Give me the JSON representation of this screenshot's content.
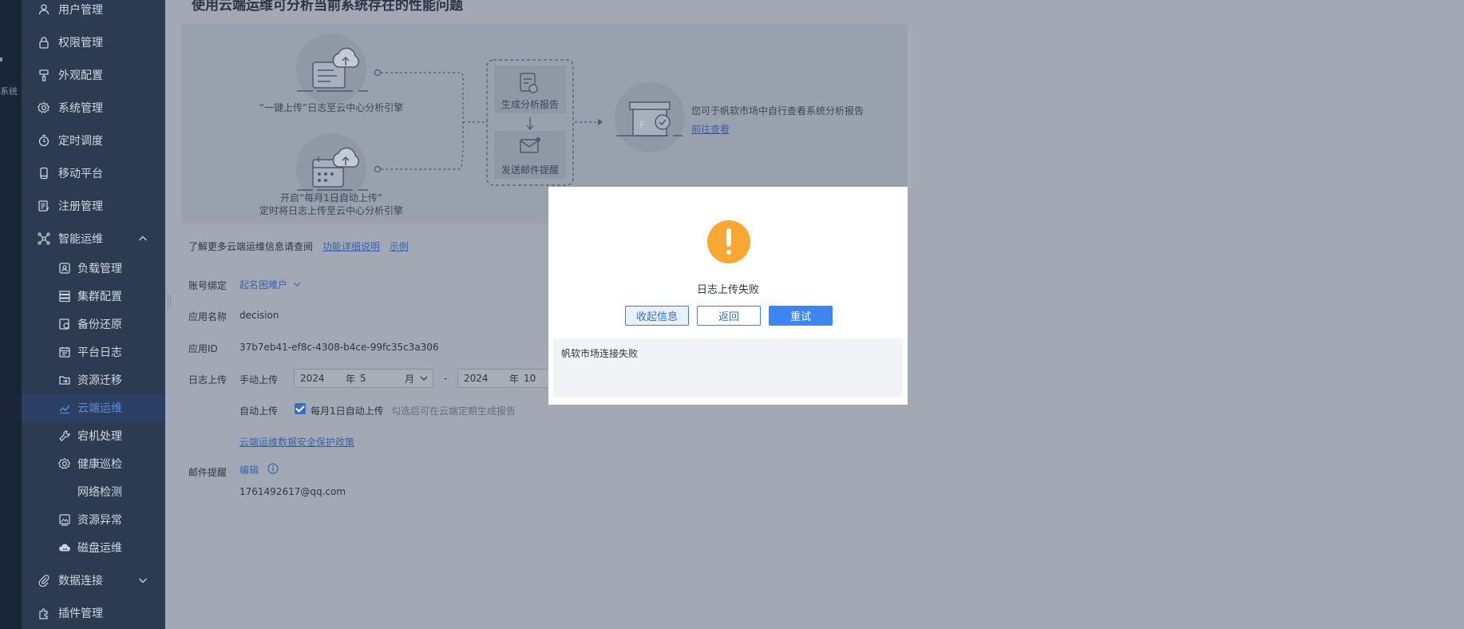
{
  "rail": {
    "top_text": "",
    "label": "系统"
  },
  "sidebar": {
    "items": [
      {
        "label": "用户管理",
        "icon": "user-icon"
      },
      {
        "label": "权限管理",
        "icon": "lock-icon"
      },
      {
        "label": "外观配置",
        "icon": "brush-icon"
      },
      {
        "label": "系统管理",
        "icon": "gear-icon"
      },
      {
        "label": "定时调度",
        "icon": "timer-icon"
      },
      {
        "label": "移动平台",
        "icon": "mobile-icon"
      },
      {
        "label": "注册管理",
        "icon": "register-icon"
      },
      {
        "label": "智能运维",
        "icon": "network-icon",
        "expanded": true
      }
    ],
    "sub_items": [
      {
        "label": "负载管理",
        "icon": "load-icon"
      },
      {
        "label": "集群配置",
        "icon": "cluster-icon"
      },
      {
        "label": "备份还原",
        "icon": "backup-icon"
      },
      {
        "label": "平台日志",
        "icon": "log-icon"
      },
      {
        "label": "资源迁移",
        "icon": "migrate-icon"
      },
      {
        "label": "云端运维",
        "icon": "cloud-trend-icon",
        "active": true
      },
      {
        "label": "宕机处理",
        "icon": "wrench-icon"
      },
      {
        "label": "健康巡检",
        "icon": "inspect-icon"
      },
      {
        "label": "网络检测",
        "icon": ""
      },
      {
        "label": "资源异常",
        "icon": "alert-image-icon"
      },
      {
        "label": "磁盘运维",
        "icon": "disk-cloud-icon"
      }
    ],
    "bottom_items": [
      {
        "label": "数据连接",
        "icon": "paperclip-icon"
      },
      {
        "label": "插件管理",
        "icon": "plugin-icon"
      }
    ]
  },
  "main": {
    "title": "使用云端运维可分析当前系统存在的性能问题",
    "flow": {
      "step1": "“一键上传”日志至云中心分析引擎",
      "step2_line1": "开启“每月1日自动上传”",
      "step2_line2": "定时将日志上传至云中心分析引擎",
      "report": "生成分析报告",
      "email": "发送邮件提醒",
      "result": "您可于帆软市场中自行查看系统分析报告",
      "result_link": "前往查看"
    },
    "learn_more": "了解更多云端运维信息请查阅",
    "learn_link1": "功能详细说明",
    "learn_link2": "示例",
    "account_label": "账号绑定",
    "account_value": "起名困难户",
    "app_name_label": "应用名称",
    "app_name_value": "decision",
    "app_id_label": "应用ID",
    "app_id_value": "37b7eb41-ef8c-4308-b4ce-99fc35c3a306",
    "log_upload_label": "日志上传",
    "manual_upload": "手动上传",
    "from_year": "2024",
    "year_unit": "年",
    "from_month": "5",
    "month_unit": "月",
    "range_sep": "-",
    "to_year": "2024",
    "to_month": "10",
    "auto_upload": "自动上传",
    "auto_checkbox": "每月1日自动上传",
    "auto_hint": "勾选后可在云端定期生成报告",
    "policy_link": "云端运维数据安全保护政策",
    "email_label": "邮件提醒",
    "email_edit": "编辑",
    "email_value": "1761492617@qq.com"
  },
  "dialog": {
    "message": "日志上传失败",
    "collapse_btn": "收起信息",
    "back_btn": "返回",
    "retry_btn": "重试",
    "detail": "帆软市场连接失败"
  }
}
